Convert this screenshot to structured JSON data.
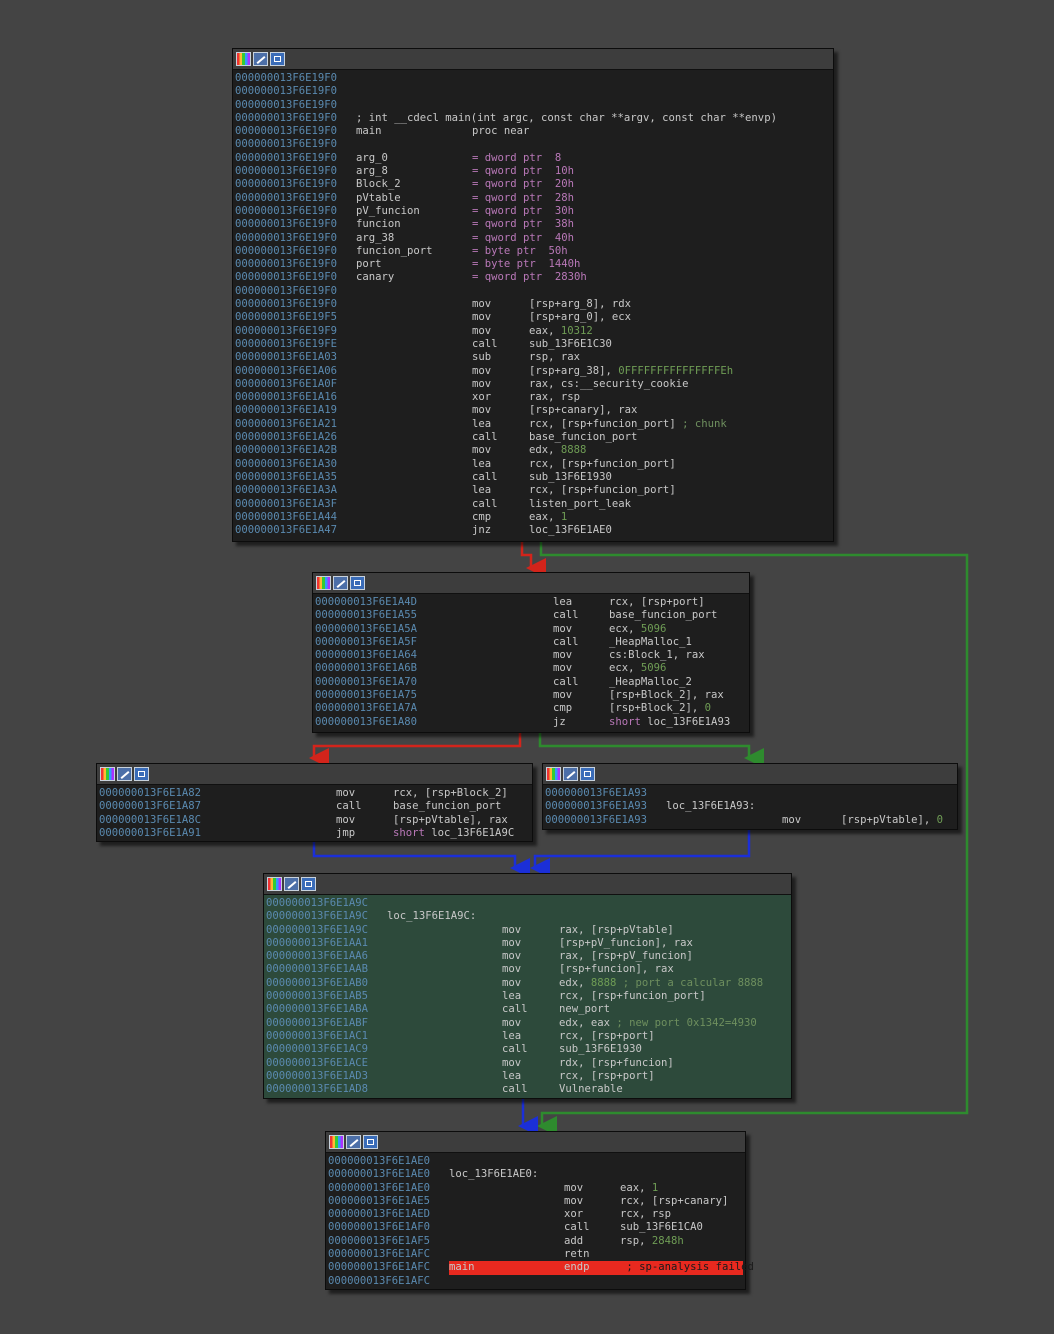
{
  "nodes": {
    "n1": {
      "lines": [
        {
          "addr": "000000013F6E19F0"
        },
        {
          "addr": "000000013F6E19F0"
        },
        {
          "addr": "000000013F6E19F0"
        },
        {
          "addr": "000000013F6E19F0",
          "comment": "; int __cdecl main(int argc, const char **argv, const char **envp)"
        },
        {
          "addr": "000000013F6E19F0",
          "label": "main",
          "mnem": "proc near"
        },
        {
          "addr": "000000013F6E19F0"
        },
        {
          "addr": "000000013F6E19F0",
          "label": "arg_0",
          "eq": "= dword ptr  8"
        },
        {
          "addr": "000000013F6E19F0",
          "label": "arg_8",
          "eq": "= qword ptr  10h"
        },
        {
          "addr": "000000013F6E19F0",
          "label": "Block_2",
          "eq": "= qword ptr  20h"
        },
        {
          "addr": "000000013F6E19F0",
          "label": "pVtable",
          "eq": "= qword ptr  28h"
        },
        {
          "addr": "000000013F6E19F0",
          "label": "pV_funcion",
          "eq": "= qword ptr  30h"
        },
        {
          "addr": "000000013F6E19F0",
          "label": "funcion",
          "eq": "= qword ptr  38h"
        },
        {
          "addr": "000000013F6E19F0",
          "label": "arg_38",
          "eq": "= qword ptr  40h"
        },
        {
          "addr": "000000013F6E19F0",
          "label": "funcion_port",
          "eq": "= byte ptr  50h"
        },
        {
          "addr": "000000013F6E19F0",
          "label": "port",
          "eq": "= byte ptr  1440h"
        },
        {
          "addr": "000000013F6E19F0",
          "label": "canary",
          "eq": "= qword ptr  2830h"
        },
        {
          "addr": "000000013F6E19F0"
        },
        {
          "addr": "000000013F6E19F0",
          "mnem": "mov",
          "op": "[rsp+arg_8], rdx"
        },
        {
          "addr": "000000013F6E19F5",
          "mnem": "mov",
          "op": "[rsp+arg_0], ecx"
        },
        {
          "addr": "000000013F6E19F9",
          "mnem": "mov",
          "op": "eax, ",
          "num": "10312"
        },
        {
          "addr": "000000013F6E19FE",
          "mnem": "call",
          "op": "sub_13F6E1C30"
        },
        {
          "addr": "000000013F6E1A03",
          "mnem": "sub",
          "op": "rsp, rax"
        },
        {
          "addr": "000000013F6E1A06",
          "mnem": "mov",
          "op": "[rsp+arg_38], ",
          "num": "0FFFFFFFFFFFFFFFEh"
        },
        {
          "addr": "000000013F6E1A0F",
          "mnem": "mov",
          "op": "rax, cs:__security_cookie"
        },
        {
          "addr": "000000013F6E1A16",
          "mnem": "xor",
          "op": "rax, rsp"
        },
        {
          "addr": "000000013F6E1A19",
          "mnem": "mov",
          "op": "[rsp+canary], rax"
        },
        {
          "addr": "000000013F6E1A21",
          "mnem": "lea",
          "op": "rcx, [rsp+funcion_port]",
          "comment": " ; chunk"
        },
        {
          "addr": "000000013F6E1A26",
          "mnem": "call",
          "op": "base_funcion_port"
        },
        {
          "addr": "000000013F6E1A2B",
          "mnem": "mov",
          "op": "edx, ",
          "num": "8888"
        },
        {
          "addr": "000000013F6E1A30",
          "mnem": "lea",
          "op": "rcx, [rsp+funcion_port]"
        },
        {
          "addr": "000000013F6E1A35",
          "mnem": "call",
          "op": "sub_13F6E1930"
        },
        {
          "addr": "000000013F6E1A3A",
          "mnem": "lea",
          "op": "rcx, [rsp+funcion_port]"
        },
        {
          "addr": "000000013F6E1A3F",
          "mnem": "call",
          "op": "listen_port_leak"
        },
        {
          "addr": "000000013F6E1A44",
          "mnem": "cmp",
          "op": "eax, ",
          "num": "1"
        },
        {
          "addr": "000000013F6E1A47",
          "mnem": "jnz",
          "op": "loc_13F6E1AE0"
        }
      ]
    },
    "n2": {
      "lines": [
        {
          "addr": "000000013F6E1A4D",
          "mnem": "lea",
          "op": "rcx, [rsp+port]"
        },
        {
          "addr": "000000013F6E1A55",
          "mnem": "call",
          "op": "base_funcion_port"
        },
        {
          "addr": "000000013F6E1A5A",
          "mnem": "mov",
          "op": "ecx, ",
          "num": "5096"
        },
        {
          "addr": "000000013F6E1A5F",
          "mnem": "call",
          "op": "_HeapMalloc_1"
        },
        {
          "addr": "000000013F6E1A64",
          "mnem": "mov",
          "op": "cs:Block_1, rax"
        },
        {
          "addr": "000000013F6E1A6B",
          "mnem": "mov",
          "op": "ecx, ",
          "num": "5096"
        },
        {
          "addr": "000000013F6E1A70",
          "mnem": "call",
          "op": "_HeapMalloc_2"
        },
        {
          "addr": "000000013F6E1A75",
          "mnem": "mov",
          "op": "[rsp+Block_2], rax"
        },
        {
          "addr": "000000013F6E1A7A",
          "mnem": "cmp",
          "op": "[rsp+Block_2], ",
          "num": "0"
        },
        {
          "addr": "000000013F6E1A80",
          "mnem": "jz",
          "kw": "short ",
          "op": "loc_13F6E1A93"
        }
      ]
    },
    "n3": {
      "lines": [
        {
          "addr": "000000013F6E1A82",
          "mnem": "mov",
          "op": "rcx, [rsp+Block_2]"
        },
        {
          "addr": "000000013F6E1A87",
          "mnem": "call",
          "op": "base_funcion_port"
        },
        {
          "addr": "000000013F6E1A8C",
          "mnem": "mov",
          "op": "[rsp+pVtable], rax"
        },
        {
          "addr": "000000013F6E1A91",
          "mnem": "jmp",
          "kw": "short ",
          "op": "loc_13F6E1A9C"
        }
      ]
    },
    "n4": {
      "lines": [
        {
          "addr": "000000013F6E1A93"
        },
        {
          "addr": "000000013F6E1A93",
          "label": "loc_13F6E1A93:"
        },
        {
          "addr": "000000013F6E1A93",
          "mnem": "mov",
          "op": "[rsp+pVtable], ",
          "num": "0"
        }
      ]
    },
    "n5": {
      "lines": [
        {
          "addr": "000000013F6E1A9C"
        },
        {
          "addr": "000000013F6E1A9C",
          "label": "loc_13F6E1A9C:"
        },
        {
          "addr": "000000013F6E1A9C",
          "mnem": "mov",
          "op": "rax, [rsp+pVtable]"
        },
        {
          "addr": "000000013F6E1AA1",
          "mnem": "mov",
          "op": "[rsp+pV_funcion], rax"
        },
        {
          "addr": "000000013F6E1AA6",
          "mnem": "mov",
          "op": "rax, [rsp+pV_funcion]"
        },
        {
          "addr": "000000013F6E1AAB",
          "mnem": "mov",
          "op": "[rsp+funcion], rax"
        },
        {
          "addr": "000000013F6E1AB0",
          "mnem": "mov",
          "op": "edx, ",
          "num": "8888",
          "comment": " ; port a calcular 8888"
        },
        {
          "addr": "000000013F6E1AB5",
          "mnem": "lea",
          "op": "rcx, [rsp+funcion_port]"
        },
        {
          "addr": "000000013F6E1ABA",
          "mnem": "call",
          "op": "new_port"
        },
        {
          "addr": "000000013F6E1ABF",
          "mnem": "mov",
          "op": "edx, eax",
          "comment": " ; new port 0x1342=4930"
        },
        {
          "addr": "000000013F6E1AC1",
          "mnem": "lea",
          "op": "rcx, [rsp+port]"
        },
        {
          "addr": "000000013F6E1AC9",
          "mnem": "call",
          "op": "sub_13F6E1930"
        },
        {
          "addr": "000000013F6E1ACE",
          "mnem": "mov",
          "op": "rdx, [rsp+funcion]"
        },
        {
          "addr": "000000013F6E1AD3",
          "mnem": "lea",
          "op": "rcx, [rsp+port]"
        },
        {
          "addr": "000000013F6E1AD8",
          "mnem": "call",
          "op": "Vulnerable"
        }
      ]
    },
    "n6": {
      "lines": [
        {
          "addr": "000000013F6E1AE0"
        },
        {
          "addr": "000000013F6E1AE0",
          "label": "loc_13F6E1AE0:"
        },
        {
          "addr": "000000013F6E1AE0",
          "mnem": "mov",
          "op": "eax, ",
          "num": "1"
        },
        {
          "addr": "000000013F6E1AE5",
          "mnem": "mov",
          "op": "rcx, [rsp+canary]"
        },
        {
          "addr": "000000013F6E1AED",
          "mnem": "xor",
          "op": "rcx, rsp"
        },
        {
          "addr": "000000013F6E1AF0",
          "mnem": "call",
          "op": "sub_13F6E1CA0"
        },
        {
          "addr": "000000013F6E1AF5",
          "mnem": "add",
          "op": "rsp, ",
          "num": "2848h"
        },
        {
          "addr": "000000013F6E1AFC",
          "mnem": "retn"
        },
        {
          "addr": "000000013F6E1AFC",
          "label": "main",
          "mnem": "endp",
          "comment": " ; sp-analysis failed",
          "fail": true
        },
        {
          "addr": "000000013F6E1AFC"
        }
      ]
    }
  },
  "colors": {
    "background": "#444444",
    "node_bg": "#1e1e1e",
    "node_highlight": "#2d4a3b",
    "address": "#5a8ab0",
    "number": "#6f9d55",
    "comment": "#6e8f5e",
    "keyword": "#b978b8",
    "edge_true": "#2e8b2e",
    "edge_false": "#d3241b",
    "edge_uncond": "#1b2fd8",
    "fail_bar": "#e8291f"
  },
  "icons": [
    "color-palette-icon",
    "edit-icon",
    "graph-view-icon"
  ]
}
